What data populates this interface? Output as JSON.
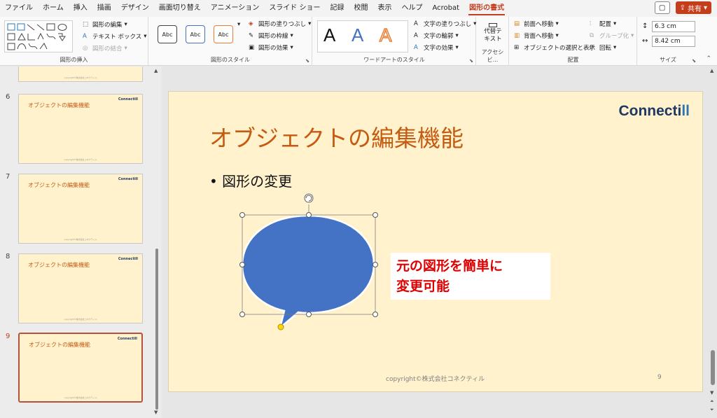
{
  "menu": {
    "tabs": [
      "ファイル",
      "ホーム",
      "挿入",
      "描画",
      "デザイン",
      "画面切り替え",
      "アニメーション",
      "スライド ショー",
      "記録",
      "校閲",
      "表示",
      "ヘルプ",
      "Acrobat",
      "図形の書式"
    ],
    "share_label": "共有"
  },
  "ribbon": {
    "insert_shapes": {
      "label": "図形の挿入",
      "edit_shape": "図形の編集",
      "text_box": "テキスト ボックス",
      "merge_shapes": "図形の結合"
    },
    "shape_styles": {
      "label": "図形のスタイル",
      "style_sample": "Abc",
      "fill": "図形の塗りつぶし",
      "outline": "図形の枠線",
      "effects": "図形の効果"
    },
    "wordart": {
      "label": "ワードアートのスタイル",
      "sample": "A",
      "text_fill": "文字の塗りつぶし",
      "text_outline": "文字の輪郭",
      "text_effects": "文字の効果"
    },
    "accessibility": {
      "label": "アクセシビ...",
      "alt_text_line1": "代替テ",
      "alt_text_line2": "キスト"
    },
    "arrange": {
      "label": "配置",
      "bring_forward": "前面へ移動",
      "send_backward": "背面へ移動",
      "selection_pane": "オブジェクトの選択と表示",
      "align": "配置",
      "group": "グループ化",
      "rotate": "回転"
    },
    "size": {
      "label": "サイズ",
      "height": "6.3 cm",
      "width": "8.42 cm"
    }
  },
  "thumbnails": [
    {
      "num": "6",
      "title": "オブジェクトの編集機能",
      "logo": "Connectill",
      "footer": "copyright©株式会社コネクティル"
    },
    {
      "num": "7",
      "title": "オブジェクトの編集機能",
      "logo": "Connectill",
      "footer": "copyright©株式会社コネクティル"
    },
    {
      "num": "8",
      "title": "オブジェクトの編集機能",
      "logo": "Connectill",
      "footer": "copyright©株式会社コネクティル"
    },
    {
      "num": "9",
      "title": "オブジェクトの編集機能",
      "logo": "Connectill",
      "footer": "copyright©株式会社コネクティル"
    }
  ],
  "slide": {
    "title": "オブジェクトの編集機能",
    "logo_main": "Connecti",
    "logo_accent": "ll",
    "bullet": "• 図形の変更",
    "callout_line1": "元の図形を簡単に",
    "callout_line2": "変更可能",
    "footer": "copyright©株式会社コネクティル",
    "page_number": "9"
  },
  "colors": {
    "accent": "#c43e1c",
    "slide_bg": "#fff2cc",
    "title": "#c55a11",
    "shape_fill": "#4472c4",
    "callout_text": "#e00000"
  }
}
